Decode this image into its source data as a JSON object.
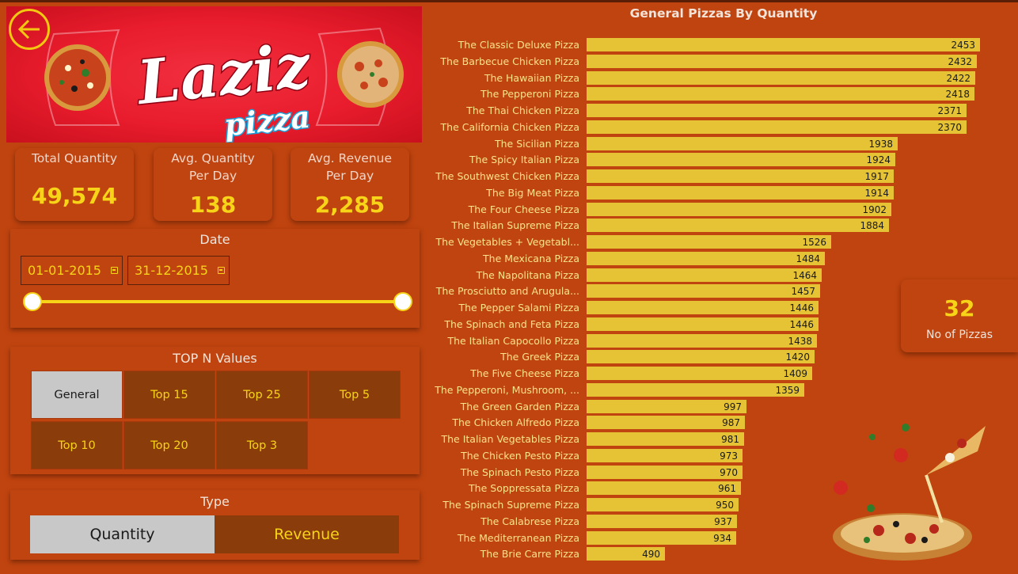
{
  "banner": {
    "brand": "Laziz",
    "sub": "pizza"
  },
  "kpis": [
    {
      "label": "Total Quantity",
      "value": "49,574"
    },
    {
      "label": "Avg. Quantity Per Day",
      "value": "138"
    },
    {
      "label": "Avg. Revenue Per Day",
      "value": "2,285"
    }
  ],
  "date_filter": {
    "title": "Date",
    "start": "01-01-2015",
    "end": "31-12-2015"
  },
  "topn": {
    "title": "TOP N Values",
    "options": [
      "General",
      "Top 15",
      "Top 25",
      "Top 5",
      "Top 10",
      "Top 20",
      "Top 3"
    ],
    "selected": "General"
  },
  "type_filter": {
    "title": "Type",
    "options": [
      "Quantity",
      "Revenue"
    ],
    "selected": "Quantity"
  },
  "count_card": {
    "value": "32",
    "label": "No of Pizzas"
  },
  "colors": {
    "background": "#c0440f",
    "bar": "#e6c335",
    "accent": "#f7d417",
    "tile": "#8a3c0a",
    "selected": "#c8c8c8"
  },
  "chart_data": {
    "type": "bar",
    "orientation": "horizontal",
    "title": "General Pizzas By Quantity",
    "categories": [
      "The Classic Deluxe Pizza",
      "The Barbecue Chicken Pizza",
      "The Hawaiian Pizza",
      "The Pepperoni Pizza",
      "The Thai Chicken Pizza",
      "The California Chicken Pizza",
      "The Sicilian Pizza",
      "The Spicy Italian Pizza",
      "The Southwest Chicken Pizza",
      "The Big Meat Pizza",
      "The Four Cheese Pizza",
      "The Italian Supreme Pizza",
      "The Vegetables + Vegetabl...",
      "The Mexicana Pizza",
      "The Napolitana Pizza",
      "The Prosciutto and Arugula...",
      "The Pepper Salami Pizza",
      "The Spinach and Feta Pizza",
      "The Italian Capocollo Pizza",
      "The Greek Pizza",
      "The Five Cheese Pizza",
      "The Pepperoni, Mushroom, ...",
      "The Green Garden Pizza",
      "The Chicken Alfredo Pizza",
      "The Italian Vegetables Pizza",
      "The Chicken Pesto Pizza",
      "The Spinach Pesto Pizza",
      "The Soppressata Pizza",
      "The Spinach Supreme Pizza",
      "The Calabrese Pizza",
      "The Mediterranean Pizza",
      "The Brie Carre Pizza"
    ],
    "values": [
      2453,
      2432,
      2422,
      2418,
      2371,
      2370,
      1938,
      1924,
      1917,
      1914,
      1902,
      1884,
      1526,
      1484,
      1464,
      1457,
      1446,
      1446,
      1438,
      1420,
      1409,
      1359,
      997,
      987,
      981,
      973,
      970,
      961,
      950,
      937,
      934,
      490
    ],
    "xlim": [
      0,
      2453
    ],
    "data_labels": true
  }
}
